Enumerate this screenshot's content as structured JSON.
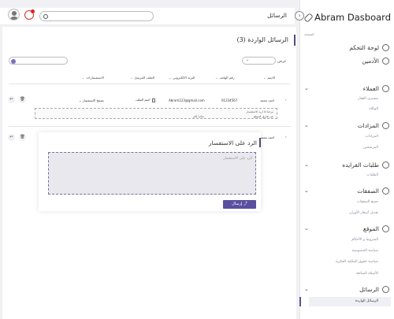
{
  "brand": {
    "name": "Abram Dasboard"
  },
  "sidebar": {
    "caption": "الصفحة",
    "sections": [
      {
        "label": "لوحة التحكم",
        "icon": "dashboard-icon",
        "has_chevron": false,
        "children": []
      },
      {
        "label": "الأدمين",
        "icon": "admin-icon",
        "has_chevron": false,
        "children": []
      },
      {
        "label": "العملاء",
        "icon": "customers-icon",
        "has_chevron": true,
        "children": [
          "مشتري العقار",
          "الوكلاء"
        ]
      },
      {
        "label": "المزادات",
        "icon": "auctions-icon",
        "has_chevron": true,
        "children": [
          "المزادات",
          "المرشحين"
        ]
      },
      {
        "label": "طلبات القرايده",
        "icon": "requests-icon",
        "has_chevron": true,
        "children": [
          "الطلبات"
        ]
      },
      {
        "label": "الصفقات",
        "icon": "deals-icon",
        "has_chevron": true,
        "children": [
          "جميع الصفقات",
          "تعديل أسعار الأوزان"
        ]
      },
      {
        "label": "الموقع",
        "icon": "site-icon",
        "has_chevron": true,
        "children": [
          "الشروط و الأحكام",
          "سياسة الخصوصية",
          "سياسة حقوق الملكية الفكرية",
          "الأسئلة الشائعة"
        ]
      },
      {
        "label": "الرسائل",
        "icon": "messages-icon",
        "has_chevron": true,
        "children": [
          "الرسائل الواردة"
        ]
      }
    ]
  },
  "header": {
    "title": "الرسائل",
    "search_placeholder": ""
  },
  "inbox": {
    "title": "الرسائل الواردة (3)",
    "show_label": "عرض",
    "show_value": "",
    "filter_placeholder": "",
    "columns": [
      "الاسم",
      "رقم الهاتف",
      "البريد الالكتروني",
      "الملف المرسل",
      "الاستفسارات"
    ],
    "rows": [
      {
        "name": "احمد محمد",
        "phone": "01234567",
        "email": "Abram123@gmail.com",
        "file": "اسم الملف",
        "inquiry": "تصفح الاستفسار",
        "message_line1": "مرحبا انا اريد الاستفسار",
        "message_line2": "عن طريق الموقع",
        "message_line3": "شكرا لكم"
      },
      {
        "name": "احمد محمد"
      }
    ]
  },
  "reply_modal": {
    "title": "الرد على الاستفسار",
    "placeholder": "الرد على الاستفسار",
    "send_label": "إرسال"
  },
  "colors": {
    "accent": "#5b4fa1",
    "modal_textarea_bg": "#e8e8ee"
  }
}
